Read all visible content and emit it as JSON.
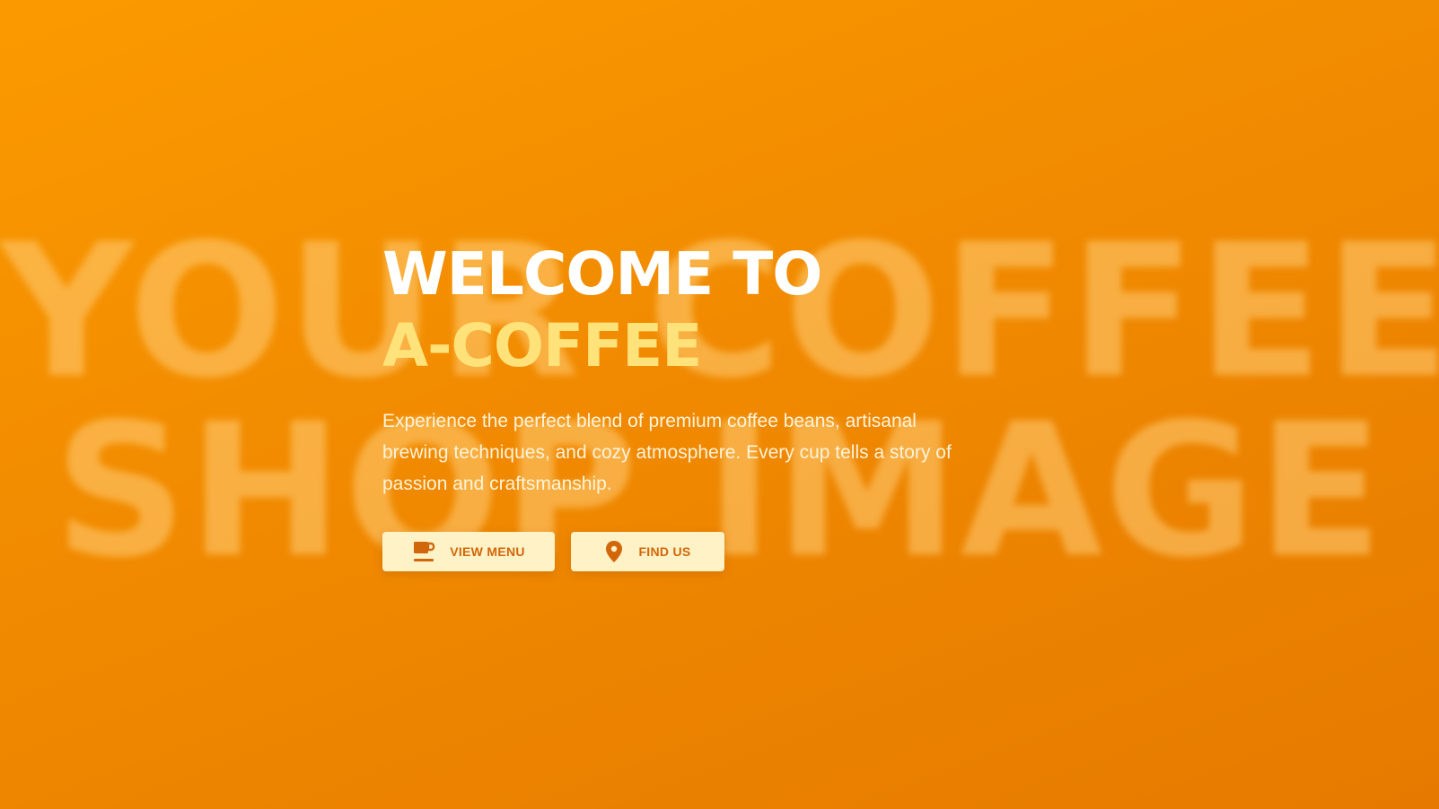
{
  "background": {
    "watermark_line_1": "YOUR COFFEE",
    "watermark_line_2": "SHOP IMAGE",
    "gradient_start": "#fb9a00",
    "gradient_end": "#e67a00"
  },
  "hero": {
    "title_line_1": "WELCOME TO",
    "title_line_2": "A-COFFEE",
    "subtitle": "Experience the perfect blend of premium coffee beans, artisanal brewing techniques, and cozy atmosphere. Every cup tells a story of passion and craftsmanship.",
    "title_color": "#ffffff",
    "accent_color": "#ffe27a"
  },
  "buttons": [
    {
      "label": "VIEW MENU",
      "icon": "coffee-cup-icon"
    },
    {
      "label": "FIND US",
      "icon": "location-pin-icon"
    }
  ],
  "theme": {
    "button_bg": "#fff2c6",
    "button_text": "#d2660a"
  }
}
